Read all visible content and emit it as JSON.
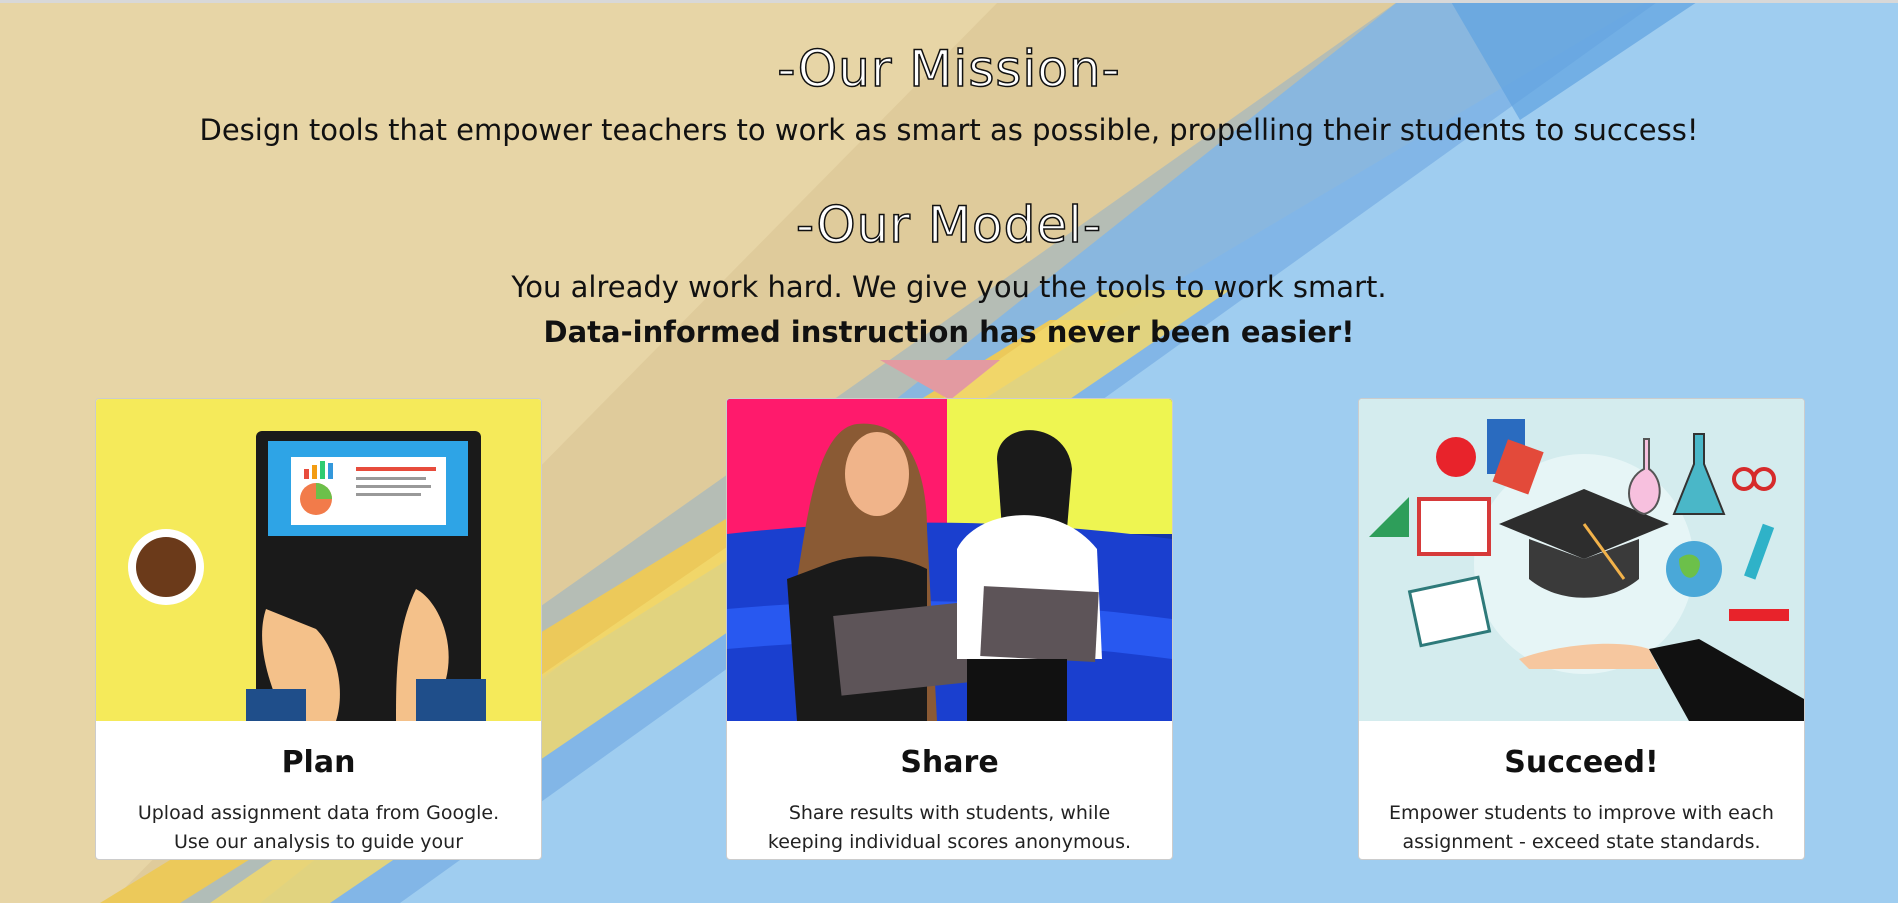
{
  "mission": {
    "title": "-Our Mission-",
    "text": "Design tools that empower teachers to work as smart as possible, propelling their students to success!"
  },
  "model": {
    "title": "-Our Model-",
    "text": "You already work hard. We give you the tools to work smart.",
    "tagline": "Data-informed instruction has never been easier!"
  },
  "cards": [
    {
      "title": "Plan",
      "text": "Upload assignment data from Google. Use our analysis to guide your instruction."
    },
    {
      "title": "Share",
      "text": "Share results with students, while keeping individual scores anonymous."
    },
    {
      "title": "Succeed!",
      "text": "Empower students to improve with each assignment - exceed state standards."
    }
  ],
  "colors": {
    "background_left": "#e6d3a2",
    "background_right": "#9ecdf0",
    "pencil": "#f0c948"
  }
}
